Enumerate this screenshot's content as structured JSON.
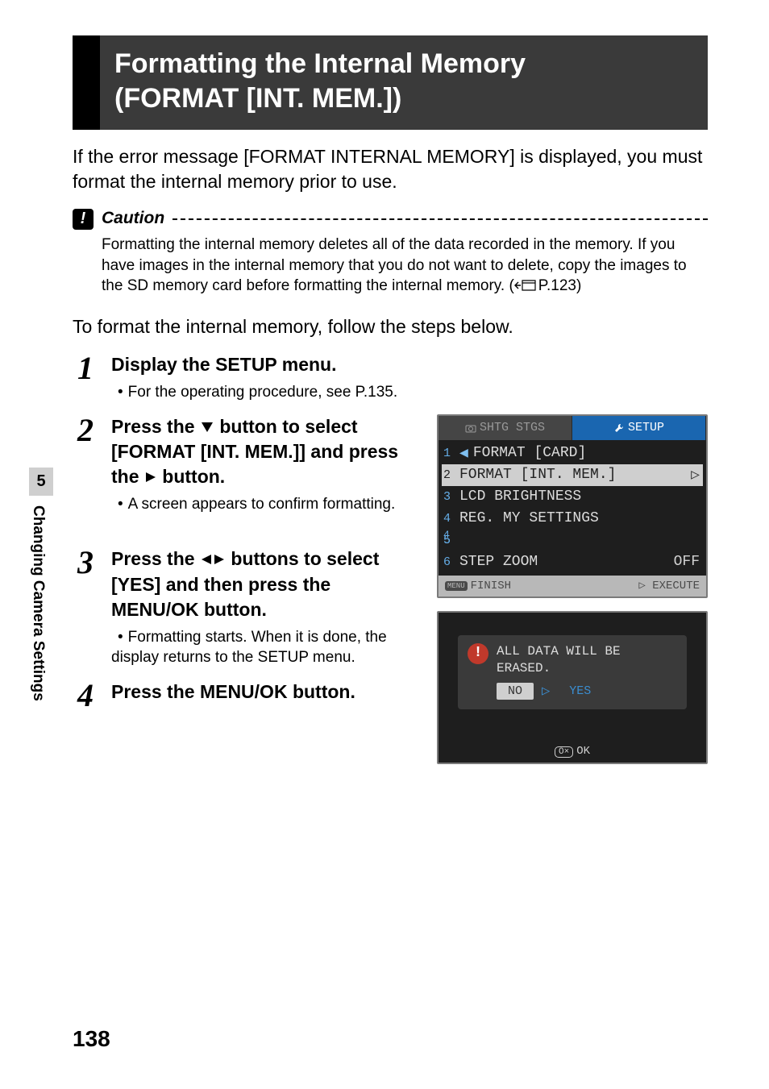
{
  "page_number": "138",
  "side_tab": {
    "chapter": "5",
    "label": "Changing Camera Settings"
  },
  "title": {
    "line1": "Formatting the Internal Memory",
    "line2": "(FORMAT [INT. MEM.])"
  },
  "intro": "If the error message [FORMAT INTERNAL MEMORY] is displayed, you must format the internal memory prior to use.",
  "caution": {
    "label": "Caution",
    "text_a": "Formatting the internal memory deletes all of the data recorded in the memory. If you have images in the internal memory that you do not want to delete, copy the images to the SD memory card before formatting the internal memory. (",
    "text_b": "P.123)"
  },
  "instruction": "To format the internal memory, follow the steps below.",
  "steps": {
    "s1": {
      "num": "1",
      "title": "Display the SETUP menu.",
      "sub": "For the operating procedure, see P.135."
    },
    "s2": {
      "num": "2",
      "title_a": "Press the ",
      "title_b": " button to select [FORMAT [INT. MEM.]] and press the ",
      "title_c": " button.",
      "sub": "A screen appears to confirm formatting."
    },
    "s3": {
      "num": "3",
      "title_a": "Press the ",
      "title_b": " buttons to select [YES] and then press the MENU/OK button.",
      "sub": "Formatting starts. When it is done, the display returns to the SETUP menu."
    },
    "s4": {
      "num": "4",
      "title": "Press the MENU/OK button."
    }
  },
  "lcd_setup": {
    "tabs": {
      "t1": "SHTG STGS",
      "t2_label": "SETUP",
      "t2_icon": "wrench-icon"
    },
    "rows": [
      {
        "idx": "1",
        "label": "FORMAT  [CARD]",
        "val": "",
        "left_mark": "◀"
      },
      {
        "idx": "2",
        "label": "FORMAT  [INT. MEM.]",
        "val": "",
        "right_mark": "▷",
        "selected": true
      },
      {
        "idx": "3",
        "label": "LCD BRIGHTNESS",
        "val": ""
      },
      {
        "idx": "4",
        "label": "REG. MY SETTINGS",
        "val": ""
      },
      {
        "idx": "5",
        "label": "",
        "val": ""
      },
      {
        "idx": "6",
        "label": "STEP ZOOM",
        "val": "OFF"
      }
    ],
    "footer": {
      "left_icon": "MENU",
      "left": "FINISH",
      "right_icon": "▷",
      "right": "EXECUTE"
    }
  },
  "lcd_confirm": {
    "msg_line1": "ALL DATA WILL BE",
    "msg_line2": "ERASED.",
    "no": "NO",
    "yes": "YES",
    "ok": "OK"
  }
}
